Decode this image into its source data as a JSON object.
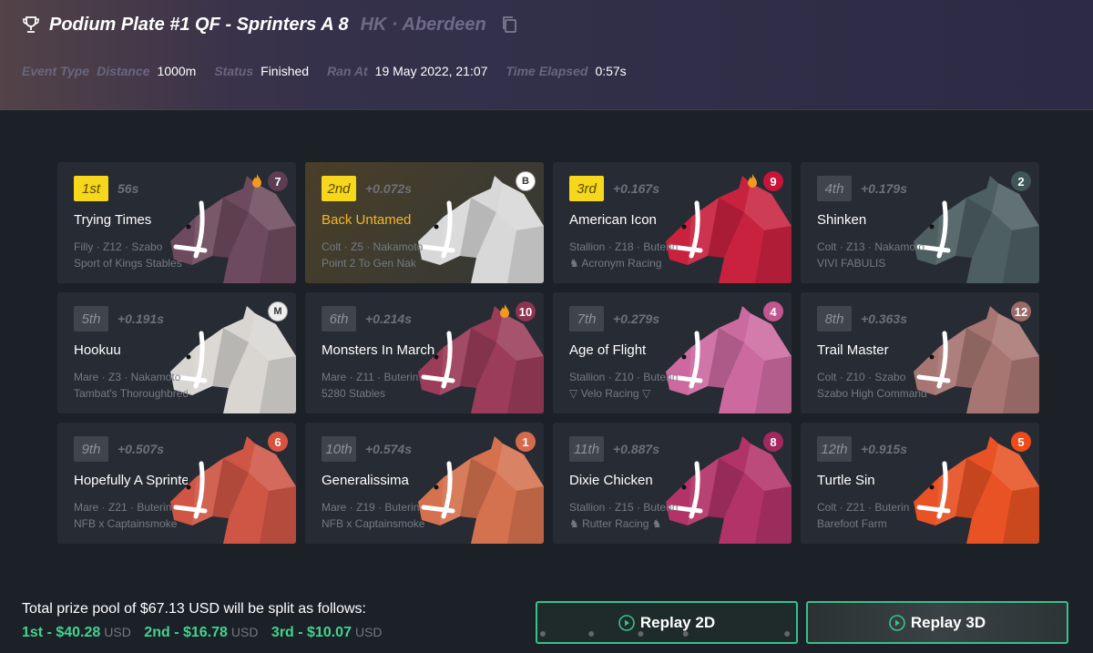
{
  "header": {
    "title": "Podium Plate #1 QF - Sprinters A 8",
    "location": "HK · Aberdeen",
    "meta": [
      {
        "label": "Event Type",
        "value": ""
      },
      {
        "label": "Distance",
        "value": "1000m"
      },
      {
        "label": "Status",
        "value": "Finished"
      },
      {
        "label": "Ran At",
        "value": "19 May 2022, 21:07"
      },
      {
        "label": "Time Elapsed",
        "value": "0:57s"
      }
    ]
  },
  "results": [
    {
      "position": "1st",
      "gap": "56s",
      "name": "Trying Times",
      "details": "Filly · Z12 · Szabo",
      "owner": "Sport of Kings Stables",
      "gate": "7",
      "gate_color": "#5c3d52",
      "horse_color": "#6e4a5e",
      "flame": true,
      "highlight": false,
      "badge_icon": ""
    },
    {
      "position": "2nd",
      "gap": "+0.072s",
      "name": "Back Untamed",
      "details": "Colt · Z5 · Nakamoto",
      "owner": "Point 2 To Gen Nak",
      "gate": "",
      "gate_color": "#ffffff",
      "horse_color": "#d8d8d8",
      "flame": false,
      "highlight": true,
      "badge_icon": "B"
    },
    {
      "position": "3rd",
      "gap": "+0.167s",
      "name": "American Icon",
      "details": "Stallion · Z18 · Buterin",
      "owner": "♞ Acronym Racing",
      "gate": "9",
      "gate_color": "#c9143a",
      "horse_color": "#c8223f",
      "flame": true,
      "highlight": false,
      "badge_icon": ""
    },
    {
      "position": "4th",
      "gap": "+0.179s",
      "name": "Shinken",
      "details": "Colt · Z13 · Nakamoto",
      "owner": "VIVI FABULIS",
      "gate": "2",
      "gate_color": "#3f5557",
      "horse_color": "#4d5f61",
      "flame": false,
      "highlight": false,
      "badge_icon": ""
    },
    {
      "position": "5th",
      "gap": "+0.191s",
      "name": "Hookuu",
      "details": "Mare · Z3 · Nakamoto",
      "owner": "Tambat's Thoroughbreds",
      "gate": "",
      "gate_color": "#eeeeee",
      "horse_color": "#d9d6d2",
      "flame": false,
      "highlight": false,
      "badge_icon": "M"
    },
    {
      "position": "6th",
      "gap": "+0.214s",
      "name": "Monsters In March",
      "details": "Mare · Z11 · Buterin",
      "owner": "5280 Stables",
      "gate": "10",
      "gate_color": "#8e3350",
      "horse_color": "#9a3c5a",
      "flame": true,
      "highlight": false,
      "badge_icon": ""
    },
    {
      "position": "7th",
      "gap": "+0.279s",
      "name": "Age of Flight",
      "details": "Stallion · Z10 · Buterin",
      "owner": "▽ Velo Racing ▽",
      "gate": "4",
      "gate_color": "#c0578f",
      "horse_color": "#cc6aa0",
      "flame": false,
      "highlight": false,
      "badge_icon": ""
    },
    {
      "position": "8th",
      "gap": "+0.363s",
      "name": "Trail Master",
      "details": "Colt · Z10 · Szabo",
      "owner": "Szabo High Command",
      "gate": "12",
      "gate_color": "#9a6a68",
      "horse_color": "#a77672",
      "flame": false,
      "highlight": false,
      "badge_icon": ""
    },
    {
      "position": "9th",
      "gap": "+0.507s",
      "name": "Hopefully A Sprinter",
      "details": "Mare · Z21 · Buterin",
      "owner": "NFB x Captainsmoke",
      "gate": "6",
      "gate_color": "#d8533f",
      "horse_color": "#cf5645",
      "flame": false,
      "highlight": false,
      "badge_icon": ""
    },
    {
      "position": "10th",
      "gap": "+0.574s",
      "name": "Generalissima",
      "details": "Mare · Z19 · Buterin",
      "owner": "NFB x Captainsmoke",
      "gate": "1",
      "gate_color": "#d66a4c",
      "horse_color": "#d4714f",
      "flame": false,
      "highlight": false,
      "badge_icon": ""
    },
    {
      "position": "11th",
      "gap": "+0.887s",
      "name": "Dixie Chicken",
      "details": "Stallion · Z15 · Buterin",
      "owner": "♞ Rutter Racing ♞",
      "gate": "8",
      "gate_color": "#a3285f",
      "horse_color": "#b23368",
      "flame": false,
      "highlight": false,
      "badge_icon": ""
    },
    {
      "position": "12th",
      "gap": "+0.915s",
      "name": "Turtle Sin",
      "details": "Colt · Z21 · Buterin",
      "owner": "Barefoot Farm",
      "gate": "5",
      "gate_color": "#ef4a1a",
      "horse_color": "#e85224",
      "flame": false,
      "highlight": false,
      "badge_icon": ""
    }
  ],
  "prize": {
    "text": "Total prize pool of $67.13 USD will be split as follows:",
    "splits": [
      {
        "label": "1st - $40.28",
        "unit": "USD"
      },
      {
        "label": "2nd - $16.78",
        "unit": "USD"
      },
      {
        "label": "3rd - $10.07",
        "unit": "USD"
      }
    ]
  },
  "buttons": {
    "replay_2d": "Replay 2D",
    "replay_3d": "Replay 3D"
  },
  "icons": {
    "trophy": "trophy-icon",
    "copy": "copy-icon",
    "flame": "flame-icon",
    "play": "play-circle-icon"
  },
  "colors": {
    "accent_green": "#43d38d",
    "gold": "#f6d71c"
  }
}
